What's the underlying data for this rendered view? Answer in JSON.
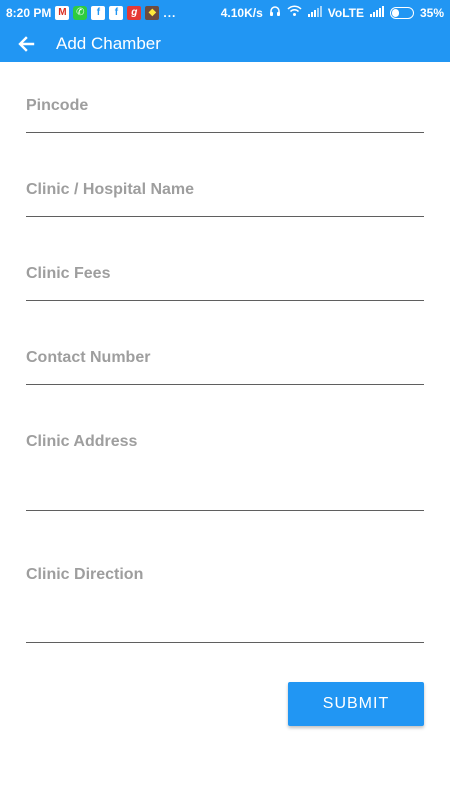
{
  "status_bar": {
    "time": "8:20 PM",
    "notifications": [
      "gmail-icon",
      "phone-icon",
      "facebook-icon",
      "facebook-icon",
      "app-g-icon",
      "game-icon"
    ],
    "more": "...",
    "network_speed": "4.10K/s",
    "carrier": "VoLTE",
    "battery": "35%",
    "battery_level": 0.35
  },
  "app_bar": {
    "title": "Add Chamber",
    "back_icon": "arrow-back-icon",
    "color": "#2196f3"
  },
  "form": {
    "fields": [
      {
        "name": "pincode",
        "label": "Pincode",
        "value": ""
      },
      {
        "name": "clinic-name",
        "label": "Clinic / Hospital Name",
        "value": ""
      },
      {
        "name": "clinic-fees",
        "label": "Clinic Fees",
        "value": ""
      },
      {
        "name": "contact-number",
        "label": "Contact Number",
        "value": ""
      },
      {
        "name": "clinic-address",
        "label": "Clinic Address",
        "value": ""
      },
      {
        "name": "clinic-direction",
        "label": "Clinic Direction",
        "value": ""
      }
    ],
    "submit_label": "SUBMIT"
  }
}
